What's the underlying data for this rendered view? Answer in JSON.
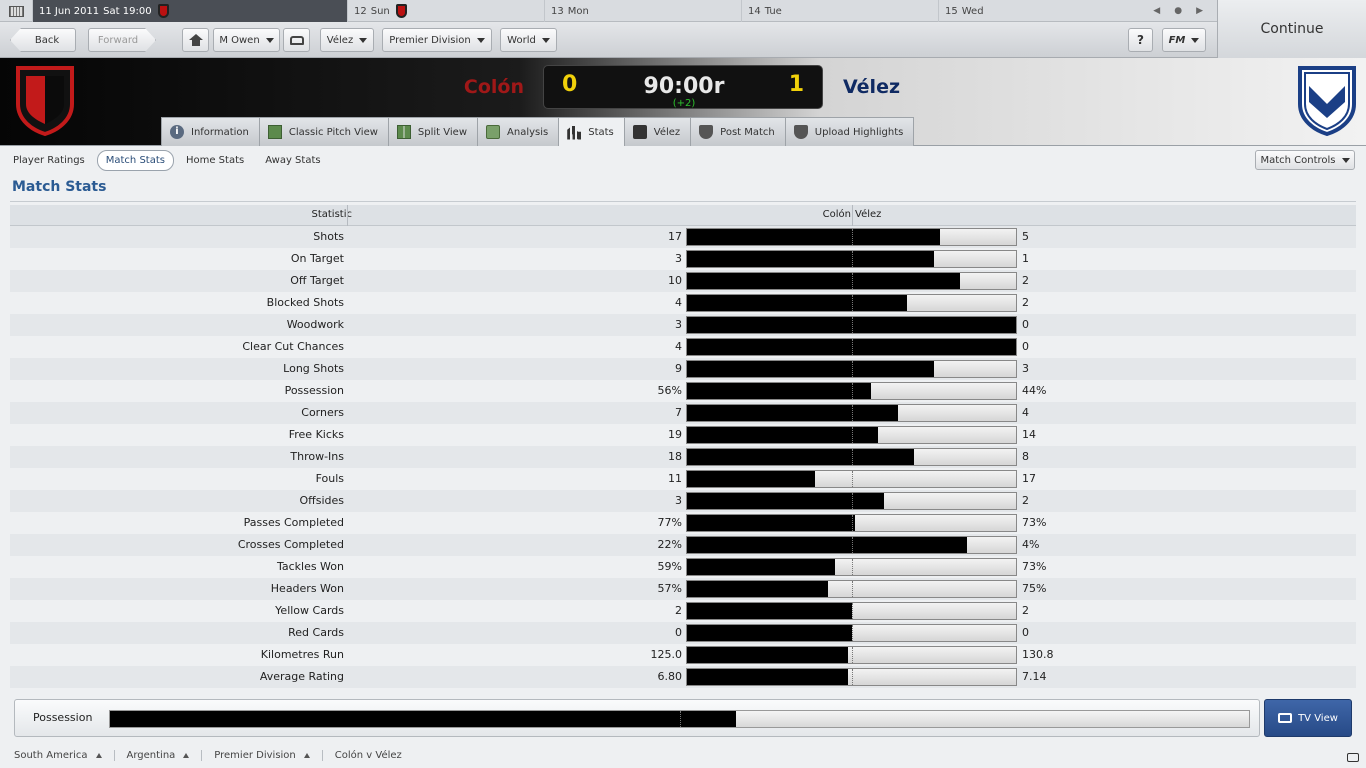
{
  "datebar": {
    "current": {
      "day": "11 Jun 2011",
      "detail": "Sat 19:00"
    },
    "days": [
      {
        "day": "12",
        "label": "Sun",
        "match": true
      },
      {
        "day": "13",
        "label": "Mon",
        "match": false
      },
      {
        "day": "14",
        "label": "Tue",
        "match": false
      },
      {
        "day": "15",
        "label": "Wed",
        "match": false
      }
    ]
  },
  "continue_label": "Continue",
  "toolbar": {
    "back": "Back",
    "forward": "Forward",
    "manager": "M Owen",
    "club": "Vélez",
    "competition": "Premier Division",
    "world": "World",
    "help": "?",
    "fm": "FM"
  },
  "match": {
    "home_team": "Colón",
    "away_team": "Vélez",
    "home_score": "0",
    "away_score": "1",
    "clock": "90:00r",
    "added_time": "(+2)"
  },
  "tabs": [
    {
      "label": "Information",
      "icon": "info-icon",
      "active": false
    },
    {
      "label": "Classic Pitch View",
      "icon": "pitch-icon",
      "active": false
    },
    {
      "label": "Split View",
      "icon": "split-view-icon",
      "active": false
    },
    {
      "label": "Analysis",
      "icon": "analysis-icon",
      "active": false
    },
    {
      "label": "Stats",
      "icon": "stats-icon",
      "active": true
    },
    {
      "label": "Vélez",
      "icon": "club-icon",
      "active": false
    },
    {
      "label": "Post Match",
      "icon": "shield-icon",
      "active": false
    },
    {
      "label": "Upload Highlights",
      "icon": "shield-icon",
      "active": false
    }
  ],
  "subtabs": [
    {
      "label": "Player Ratings",
      "active": false
    },
    {
      "label": "Match Stats",
      "active": true
    },
    {
      "label": "Home Stats",
      "active": false
    },
    {
      "label": "Away Stats",
      "active": false
    }
  ],
  "match_controls": "Match Controls",
  "panel_title": "Match Stats",
  "table_header": {
    "statistic": "Statistic",
    "home": "Colón",
    "away": "Vélez"
  },
  "stats": [
    {
      "label": "Shots",
      "home": "17",
      "away": "5",
      "home_share": 0.77
    },
    {
      "label": "On Target",
      "home": "3",
      "away": "1",
      "home_share": 0.75
    },
    {
      "label": "Off Target",
      "home": "10",
      "away": "2",
      "home_share": 0.83
    },
    {
      "label": "Blocked Shots",
      "home": "4",
      "away": "2",
      "home_share": 0.67
    },
    {
      "label": "Woodwork",
      "home": "3",
      "away": "0",
      "home_share": 1.0
    },
    {
      "label": "Clear Cut Chances",
      "home": "4",
      "away": "0",
      "home_share": 1.0
    },
    {
      "label": "Long Shots",
      "home": "9",
      "away": "3",
      "home_share": 0.75
    },
    {
      "label": "Possession",
      "home": "56%",
      "away": "44%",
      "home_share": 0.56
    },
    {
      "label": "Corners",
      "home": "7",
      "away": "4",
      "home_share": 0.64
    },
    {
      "label": "Free Kicks",
      "home": "19",
      "away": "14",
      "home_share": 0.58
    },
    {
      "label": "Throw-Ins",
      "home": "18",
      "away": "8",
      "home_share": 0.69
    },
    {
      "label": "Fouls",
      "home": "11",
      "away": "17",
      "home_share": 0.39
    },
    {
      "label": "Offsides",
      "home": "3",
      "away": "2",
      "home_share": 0.6
    },
    {
      "label": "Passes Completed",
      "home": "77%",
      "away": "73%",
      "home_share": 0.51
    },
    {
      "label": "Crosses Completed",
      "home": "22%",
      "away": "4%",
      "home_share": 0.85
    },
    {
      "label": "Tackles Won",
      "home": "59%",
      "away": "73%",
      "home_share": 0.45
    },
    {
      "label": "Headers Won",
      "home": "57%",
      "away": "75%",
      "home_share": 0.43
    },
    {
      "label": "Yellow Cards",
      "home": "2",
      "away": "2",
      "home_share": 0.5
    },
    {
      "label": "Red Cards",
      "home": "0",
      "away": "0",
      "home_share": 0.5
    },
    {
      "label": "Kilometres Run",
      "home": "125.0",
      "away": "130.8",
      "home_share": 0.49
    },
    {
      "label": "Average Rating",
      "home": "6.80",
      "away": "7.14",
      "home_share": 0.49
    }
  ],
  "possession_panel": {
    "label": "Possession",
    "home_share": 0.55
  },
  "tv_view": "TV View",
  "breadcrumbs": [
    "South America",
    "Argentina",
    "Premier Division",
    "Colón v Vélez"
  ],
  "colors": {
    "home": "#a01818",
    "away": "#0f2a63",
    "score": "#f1d10a",
    "accent": "#2b5b93"
  }
}
